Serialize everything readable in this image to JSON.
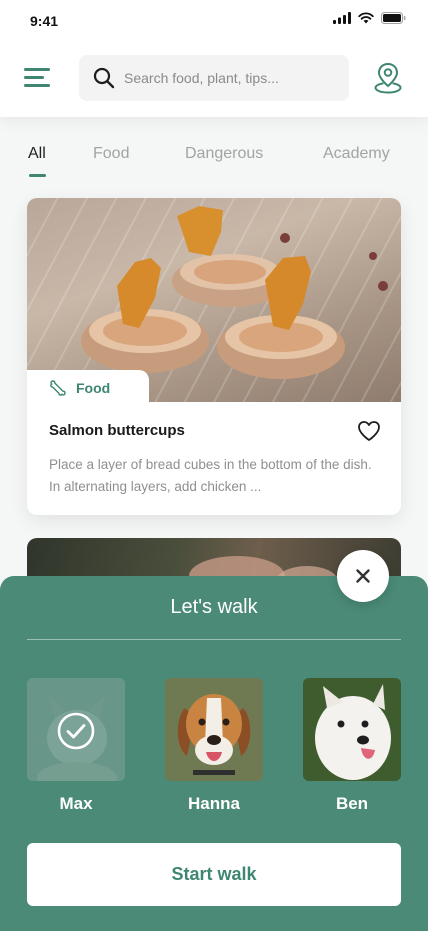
{
  "status_bar": {
    "time": "9:41"
  },
  "header": {
    "search_placeholder": "Search food, plant, tips...",
    "icons": [
      "menu-icon",
      "search-icon",
      "location-pin-icon"
    ]
  },
  "tabs": [
    {
      "label": "All",
      "active": true
    },
    {
      "label": "Food",
      "active": false
    },
    {
      "label": "Dangerous",
      "active": false
    },
    {
      "label": "Academy",
      "active": false
    }
  ],
  "cards": [
    {
      "tag": "Food",
      "tag_icon": "bone-icon",
      "title": "Salmon buttercups",
      "description": "Place a layer of bread cubes in the bottom of the dish. In alternating layers, add chicken ...",
      "favorite": false
    }
  ],
  "walk_sheet": {
    "title": "Let's walk",
    "dogs": [
      {
        "name": "Max",
        "selected": true
      },
      {
        "name": "Hanna",
        "selected": false
      },
      {
        "name": "Ben",
        "selected": false
      }
    ],
    "start_label": "Start walk"
  },
  "colors": {
    "accent": "#3f8672",
    "sheet": "#4a8a76",
    "background": "#f5f6f6"
  }
}
